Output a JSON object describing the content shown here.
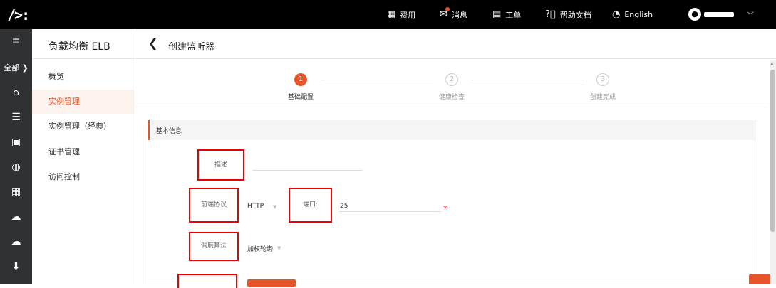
{
  "topbar": {
    "logo": "/>:",
    "items": [
      {
        "icon": "cost-icon",
        "label": "费用"
      },
      {
        "icon": "message-icon",
        "label": "消息"
      },
      {
        "icon": "ticket-icon",
        "label": "工单"
      },
      {
        "icon": "help-icon",
        "label": "帮助文档"
      },
      {
        "icon": "globe-icon",
        "label": "English"
      }
    ]
  },
  "rail": {
    "all_label": "全部",
    "icons": [
      "menu-icon",
      "home-icon",
      "database-icon",
      "storage-icon",
      "network-icon",
      "disk-icon",
      "cloud-upload-icon",
      "cloud-icon",
      "download-icon"
    ]
  },
  "sidenav": {
    "title": "负载均衡 ELB",
    "items": [
      {
        "label": "概览",
        "active": false
      },
      {
        "label": "实例管理",
        "active": true
      },
      {
        "label": "实例管理（经典）",
        "active": false
      },
      {
        "label": "证书管理",
        "active": false
      },
      {
        "label": "访问控制",
        "active": false
      }
    ]
  },
  "page": {
    "title": "创建监听器"
  },
  "steps": [
    {
      "num": "1",
      "label": "基础配置",
      "state": "current"
    },
    {
      "num": "2",
      "label": "健康检查",
      "state": "todo"
    },
    {
      "num": "3",
      "label": "创建完成",
      "state": "todo"
    }
  ],
  "form": {
    "section_title": "基本信息",
    "description_label": "描述",
    "description_value": "",
    "frontend_protocol_label": "前端协议",
    "frontend_protocol_value": "HTTP",
    "port_label": "端口:",
    "port_value": "25",
    "scheduling_label": "调度算法",
    "scheduling_value": "加权轮询"
  },
  "colors": {
    "accent": "#e8542a",
    "highlight_box": "#ee0000"
  }
}
